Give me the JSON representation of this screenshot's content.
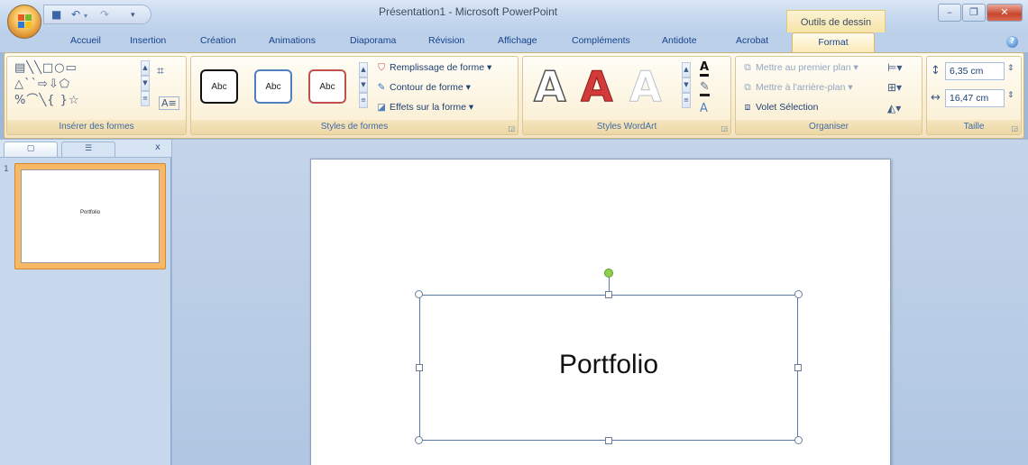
{
  "window": {
    "title": "Présentation1 - Microsoft PowerPoint",
    "context_tab_group": "Outils de dessin"
  },
  "quick_access": {
    "save_icon": "save-icon",
    "undo_icon": "undo-icon",
    "redo_icon": "redo-icon"
  },
  "tabs": [
    "Accueil",
    "Insertion",
    "Création",
    "Animations",
    "Diaporama",
    "Révision",
    "Affichage",
    "Compléments",
    "Antidote",
    "Acrobat",
    "Format"
  ],
  "active_tab": "Format",
  "ribbon": {
    "insert_shapes": {
      "label": "Insérer des formes"
    },
    "shape_styles": {
      "label": "Styles de formes",
      "style_samples": [
        "Abc",
        "Abc",
        "Abc"
      ],
      "fill": "Remplissage de forme",
      "outline": "Contour de forme",
      "effects": "Effets sur la forme"
    },
    "wordart": {
      "label": "Styles WordArt",
      "letters": [
        "A",
        "A",
        "A"
      ]
    },
    "arrange": {
      "label": "Organiser",
      "bring_front": "Mettre au premier plan",
      "send_back": "Mettre à l'arrière-plan",
      "selection_pane": "Volet Sélection"
    },
    "size": {
      "label": "Taille",
      "height": "6,35 cm",
      "width": "16,47 cm"
    }
  },
  "slides_panel": {
    "slide_number": "1",
    "thumbnail_text": "Portfolio"
  },
  "slide": {
    "title_text": "Portfolio"
  },
  "colors": {
    "ribbon_bg": "#fbf1d8",
    "accent_tab": "#fbeab4",
    "workspace": "#c4d5ea",
    "rotation_handle": "#8fd14f"
  }
}
